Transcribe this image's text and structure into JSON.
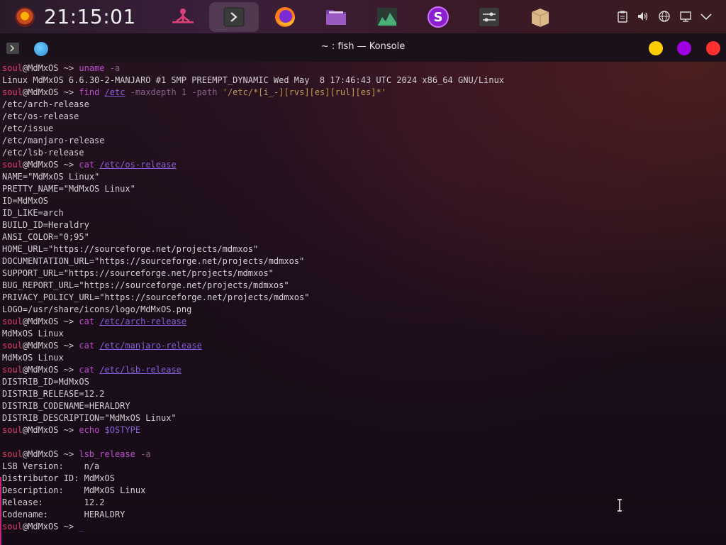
{
  "panel": {
    "clock": "21:15:01",
    "tasks": [
      {
        "name": "pin-icon",
        "active": false
      },
      {
        "name": "konsole-icon",
        "active": true
      },
      {
        "name": "firefox-icon",
        "active": false
      },
      {
        "name": "file-manager-icon",
        "active": false
      },
      {
        "name": "system-monitor-icon",
        "active": false
      },
      {
        "name": "app-s-icon",
        "active": false
      },
      {
        "name": "settings-icon",
        "active": false
      },
      {
        "name": "package-icon",
        "active": false
      }
    ],
    "tray": [
      "clipboard-icon",
      "volume-icon",
      "network-globe-icon",
      "display-icon",
      "chevron-down-icon"
    ]
  },
  "window": {
    "title": "~ : fish — Konsole",
    "accent_yellow": "#ffcc00",
    "accent_purple": "#a000e0",
    "accent_red": "#ff3030"
  },
  "prompt": {
    "user": "soul",
    "host": "@MdMxOS",
    "path": " ~> "
  },
  "terminal": {
    "lines": [
      {
        "t": "prompt",
        "cmd": "uname",
        "rest": " -a"
      },
      {
        "t": "out",
        "text": "Linux MdMxOS 6.6.30-2-MANJARO #1 SMP PREEMPT_DYNAMIC Wed May  8 17:46:43 UTC 2024 x86_64 GNU/Linux"
      },
      {
        "t": "prompt",
        "cmd": "find",
        "path": "/etc",
        "rest": " -maxdepth 1 -path ",
        "str": "'/etc/*[i_-][rvs][es][rul][es]*'"
      },
      {
        "t": "out",
        "text": "/etc/arch-release"
      },
      {
        "t": "out",
        "text": "/etc/os-release"
      },
      {
        "t": "out",
        "text": "/etc/issue"
      },
      {
        "t": "out",
        "text": "/etc/manjaro-release"
      },
      {
        "t": "out",
        "text": "/etc/lsb-release"
      },
      {
        "t": "prompt",
        "cmd": "cat",
        "path": "/etc/os-release"
      },
      {
        "t": "out",
        "text": "NAME=\"MdMxOS Linux\""
      },
      {
        "t": "out",
        "text": "PRETTY_NAME=\"MdMxOS Linux\""
      },
      {
        "t": "out",
        "text": "ID=MdMxOS"
      },
      {
        "t": "out",
        "text": "ID_LIKE=arch"
      },
      {
        "t": "out",
        "text": "BUILD_ID=Heraldry"
      },
      {
        "t": "out",
        "text": "ANSI_COLOR=\"0;95\""
      },
      {
        "t": "out",
        "text": "HOME_URL=\"https://sourceforge.net/projects/mdmxos\""
      },
      {
        "t": "out",
        "text": "DOCUMENTATION_URL=\"https://sourceforge.net/projects/mdmxos\""
      },
      {
        "t": "out",
        "text": "SUPPORT_URL=\"https://sourceforge.net/projects/mdmxos\""
      },
      {
        "t": "out",
        "text": "BUG_REPORT_URL=\"https://sourceforge.net/projects/mdmxos\""
      },
      {
        "t": "out",
        "text": "PRIVACY_POLICY_URL=\"https://sourceforge.net/projects/mdmxos\""
      },
      {
        "t": "out",
        "text": "LOGO=/usr/share/icons/logo/MdMxOS.png"
      },
      {
        "t": "prompt",
        "cmd": "cat",
        "path": "/etc/arch-release"
      },
      {
        "t": "out",
        "text": "MdMxOS Linux"
      },
      {
        "t": "prompt",
        "cmd": "cat",
        "path": "/etc/manjaro-release"
      },
      {
        "t": "out",
        "text": "MdMxOS Linux"
      },
      {
        "t": "prompt",
        "cmd": "cat",
        "path": "/etc/lsb-release"
      },
      {
        "t": "out",
        "text": "DISTRIB_ID=MdMxOS"
      },
      {
        "t": "out",
        "text": "DISTRIB_RELEASE=12.2"
      },
      {
        "t": "out",
        "text": "DISTRIB_CODENAME=HERALDRY"
      },
      {
        "t": "out",
        "text": "DISTRIB_DESCRIPTION=\"MdMxOS Linux\""
      },
      {
        "t": "prompt",
        "cmd": "echo",
        "var": "$OSTYPE"
      },
      {
        "t": "out",
        "text": ""
      },
      {
        "t": "prompt",
        "cmd": "lsb_release",
        "rest": " -a"
      },
      {
        "t": "out",
        "text": "LSB Version:    n/a"
      },
      {
        "t": "out",
        "text": "Distributor ID: MdMxOS"
      },
      {
        "t": "out",
        "text": "Description:    MdMxOS Linux"
      },
      {
        "t": "out",
        "text": "Release:        12.2"
      },
      {
        "t": "out",
        "text": "Codename:       HERALDRY"
      },
      {
        "t": "prompt",
        "cursor": "_"
      }
    ]
  }
}
